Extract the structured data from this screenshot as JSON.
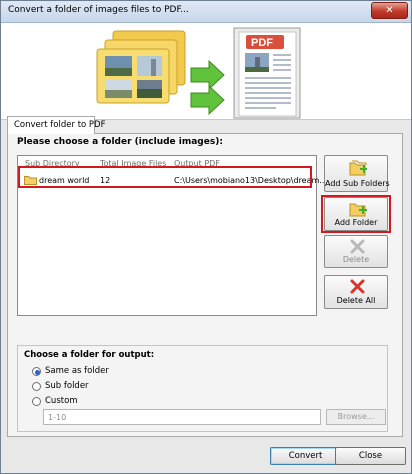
{
  "window": {
    "title": "Convert a folder of images files to PDF..."
  },
  "tab": {
    "label": "Convert folder to PDF"
  },
  "main": {
    "heading": "Please choose a folder (include images):",
    "columns": [
      "Sub Directory",
      "Total Image Files",
      "Output PDF"
    ],
    "rows": [
      {
        "name": "dream world",
        "count": "12",
        "output": "C:\\Users\\mobiano13\\Desktop\\dream..."
      }
    ]
  },
  "side_buttons": {
    "add_sub_folders": "Add Sub Folders",
    "add_folder": "Add Folder",
    "delete": "Delete",
    "delete_all": "Delete All"
  },
  "output": {
    "label": "Choose a folder for output:",
    "options": [
      "Same as folder",
      "Sub folder",
      "Custom"
    ],
    "selected": "Same as folder",
    "custom_placeholder": "1-10",
    "browse": "Browse..."
  },
  "footer": {
    "convert": "Convert",
    "close": "Close"
  },
  "colors": {
    "highlight": "#d2191f",
    "selection": "#2b62c8"
  }
}
